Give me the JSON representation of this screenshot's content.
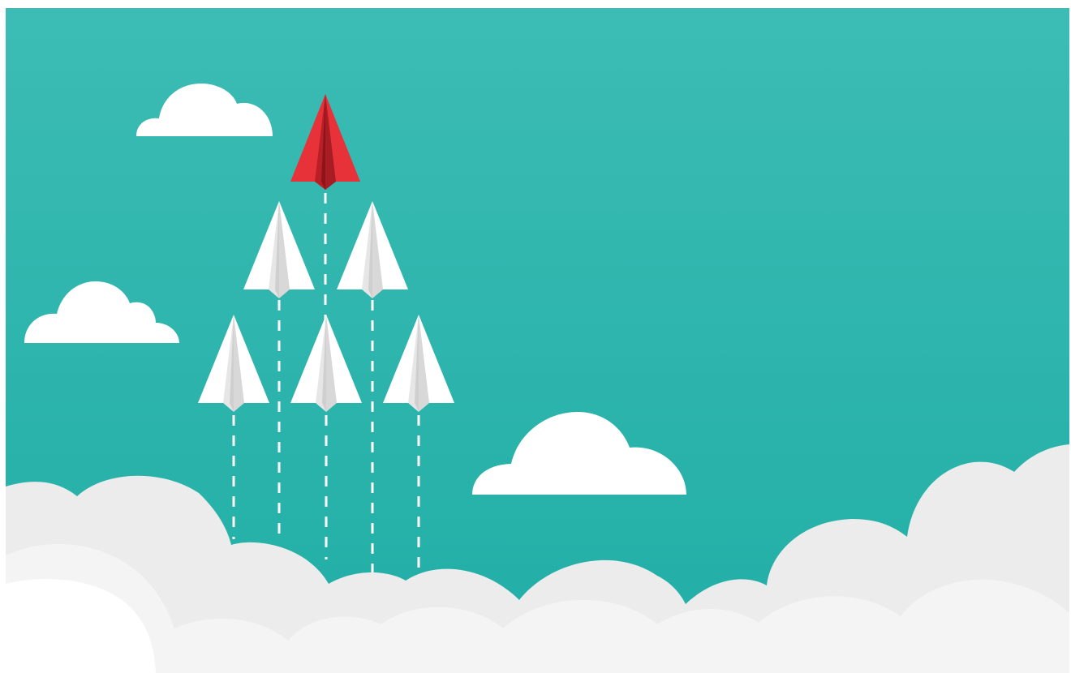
{
  "scene": {
    "description_free": true,
    "colors": {
      "sky_top": "#3cbcb4",
      "sky_bottom": "#20aea6",
      "leader_plane": "#e8323a",
      "leader_plane_dark": "#b81f27",
      "leader_plane_shadow": "#8e141a",
      "follower_plane": "#ffffff",
      "follower_plane_shade": "#e6e6e6",
      "follower_plane_dark": "#cfcfcf",
      "cloud_white": "#ffffff",
      "cloud_bank_light": "#ececec",
      "cloud_bank_lighter": "#f4f4f4",
      "trail": "#ffffff"
    },
    "icons": {
      "leader": "red-paper-plane-icon",
      "followers": "white-paper-plane-icon",
      "clouds": "cloud-icon"
    },
    "formation": {
      "leader_count": 1,
      "second_row_count": 2,
      "third_row_count": 3
    }
  }
}
